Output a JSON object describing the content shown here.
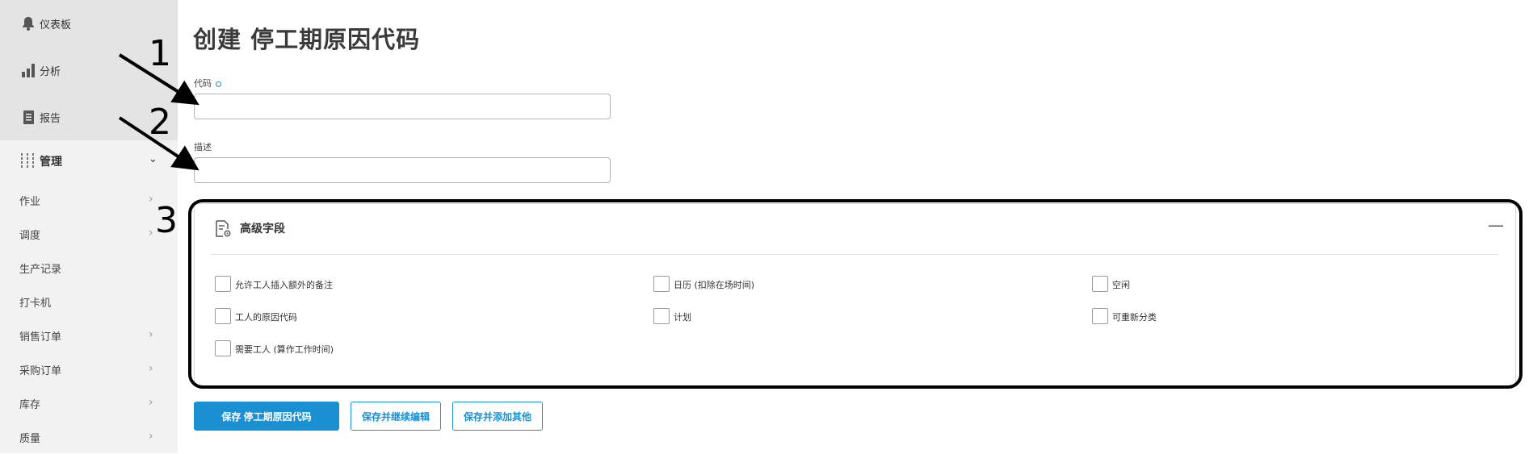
{
  "sidebar": {
    "top_items": [
      {
        "label": "仪表板",
        "icon": "bell-icon"
      },
      {
        "label": "分析",
        "icon": "bar-chart-icon"
      },
      {
        "label": "报告",
        "icon": "document-icon"
      }
    ],
    "admin": {
      "label": "管理",
      "icon": "sliders-icon",
      "chevron": "chevron-down-icon"
    },
    "sub_items": [
      {
        "label": "作业",
        "has_chevron": true
      },
      {
        "label": "调度",
        "has_chevron": true
      },
      {
        "label": "生产记录",
        "has_chevron": false
      },
      {
        "label": "打卡机",
        "has_chevron": false
      },
      {
        "label": "销售订单",
        "has_chevron": true
      },
      {
        "label": "采购订单",
        "has_chevron": true
      },
      {
        "label": "库存",
        "has_chevron": true
      },
      {
        "label": "质量",
        "has_chevron": true
      }
    ]
  },
  "page": {
    "title": "创建 停工期原因代码"
  },
  "form": {
    "code": {
      "label": "代码",
      "value": "",
      "required": true
    },
    "description": {
      "label": "描述",
      "value": ""
    }
  },
  "advanced": {
    "title": "高级字段",
    "collapse_symbol": "—",
    "checkboxes": [
      {
        "label": "允许工人插入额外的备注",
        "checked": false
      },
      {
        "label": "日历 (扣除在场时间)",
        "checked": false
      },
      {
        "label": "空闲",
        "checked": false
      },
      {
        "label": "工人的原因代码",
        "checked": false
      },
      {
        "label": "计划",
        "checked": false
      },
      {
        "label": "可重新分类",
        "checked": false
      },
      {
        "label": "需要工人 (算作工作时间)",
        "checked": false
      }
    ]
  },
  "buttons": {
    "save": "保存 停工期原因代码",
    "save_continue": "保存并继续编辑",
    "save_add": "保存并添加其他"
  },
  "annotations": {
    "labels": [
      "1",
      "2",
      "3"
    ]
  },
  "colors": {
    "accent": "#1a8fd1",
    "sidebar_bg": "#f2f2f2",
    "sidebar_active_bg": "#e4e4e4"
  }
}
